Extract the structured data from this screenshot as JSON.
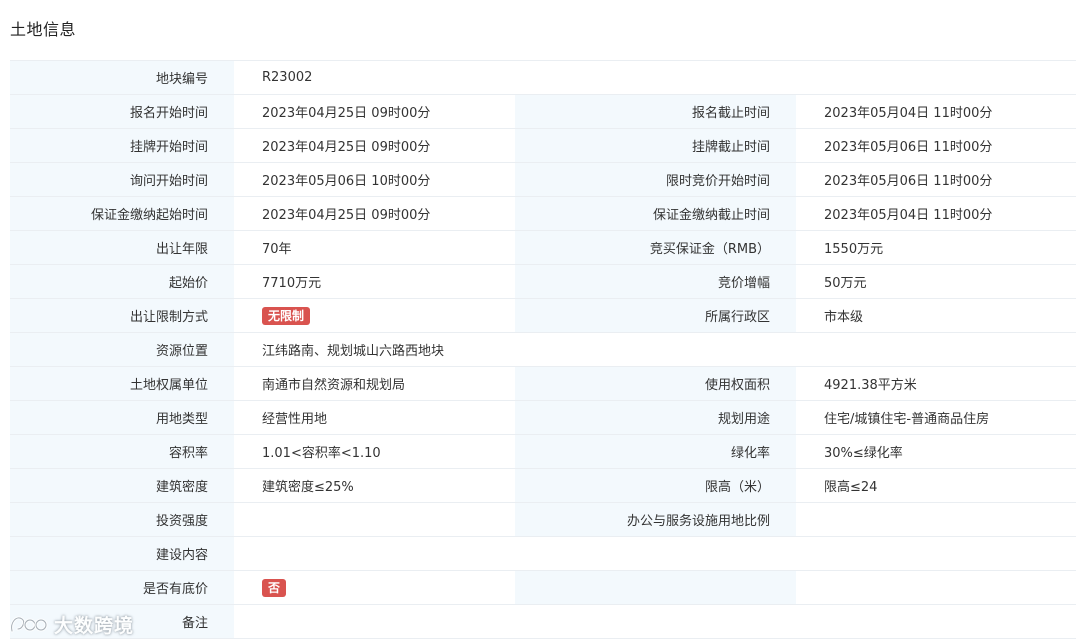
{
  "section_title": "土地信息",
  "fields": {
    "plot_no": {
      "label": "地块编号",
      "value": "R23002"
    },
    "reg_start": {
      "label": "报名开始时间",
      "value": "2023年04月25日 09时00分"
    },
    "reg_end": {
      "label": "报名截止时间",
      "value": "2023年05月04日 11时00分"
    },
    "list_start": {
      "label": "挂牌开始时间",
      "value": "2023年04月25日 09时00分"
    },
    "list_end": {
      "label": "挂牌截止时间",
      "value": "2023年05月06日 11时00分"
    },
    "inquiry_start": {
      "label": "询问开始时间",
      "value": "2023年05月06日 10时00分"
    },
    "bid_start": {
      "label": "限时竞价开始时间",
      "value": "2023年05月06日 11时00分"
    },
    "deposit_start": {
      "label": "保证金缴纳起始时间",
      "value": "2023年04月25日 09时00分"
    },
    "deposit_end": {
      "label": "保证金缴纳截止时间",
      "value": "2023年05月04日 11时00分"
    },
    "term": {
      "label": "出让年限",
      "value": "70年"
    },
    "deposit_amount": {
      "label": "竞买保证金（RMB）",
      "value": "1550万元"
    },
    "start_price": {
      "label": "起始价",
      "value": "7710万元"
    },
    "increment": {
      "label": "竞价增幅",
      "value": "50万元"
    },
    "restriction": {
      "label": "出让限制方式",
      "value": "无限制"
    },
    "district": {
      "label": "所属行政区",
      "value": "市本级"
    },
    "location": {
      "label": "资源位置",
      "value": "江纬路南、规划城山六路西地块"
    },
    "owner": {
      "label": "土地权属单位",
      "value": "南通市自然资源和规划局"
    },
    "area": {
      "label": "使用权面积",
      "value": "4921.38平方米"
    },
    "land_type": {
      "label": "用地类型",
      "value": "经营性用地"
    },
    "planned_use": {
      "label": "规划用途",
      "value": "住宅/城镇住宅-普通商品住房"
    },
    "far": {
      "label": "容积率",
      "value": "1.01<容积率<1.10"
    },
    "green_rate": {
      "label": "绿化率",
      "value": "30%≤绿化率"
    },
    "density": {
      "label": "建筑密度",
      "value": "建筑密度≤25%"
    },
    "height": {
      "label": "限高（米）",
      "value": "限高≤24"
    },
    "investment": {
      "label": "投资强度",
      "value": ""
    },
    "office_ratio": {
      "label": "办公与服务设施用地比例",
      "value": ""
    },
    "construction": {
      "label": "建设内容",
      "value": ""
    },
    "reserve": {
      "label": "是否有底价",
      "value": "否"
    },
    "remarks": {
      "label": "备注",
      "value": ""
    }
  },
  "watermark": {
    "text": "大数跨境"
  },
  "colors": {
    "label_bg": "#f3f9fd",
    "badge_red": "#d9534f",
    "border": "#eaeef2"
  }
}
